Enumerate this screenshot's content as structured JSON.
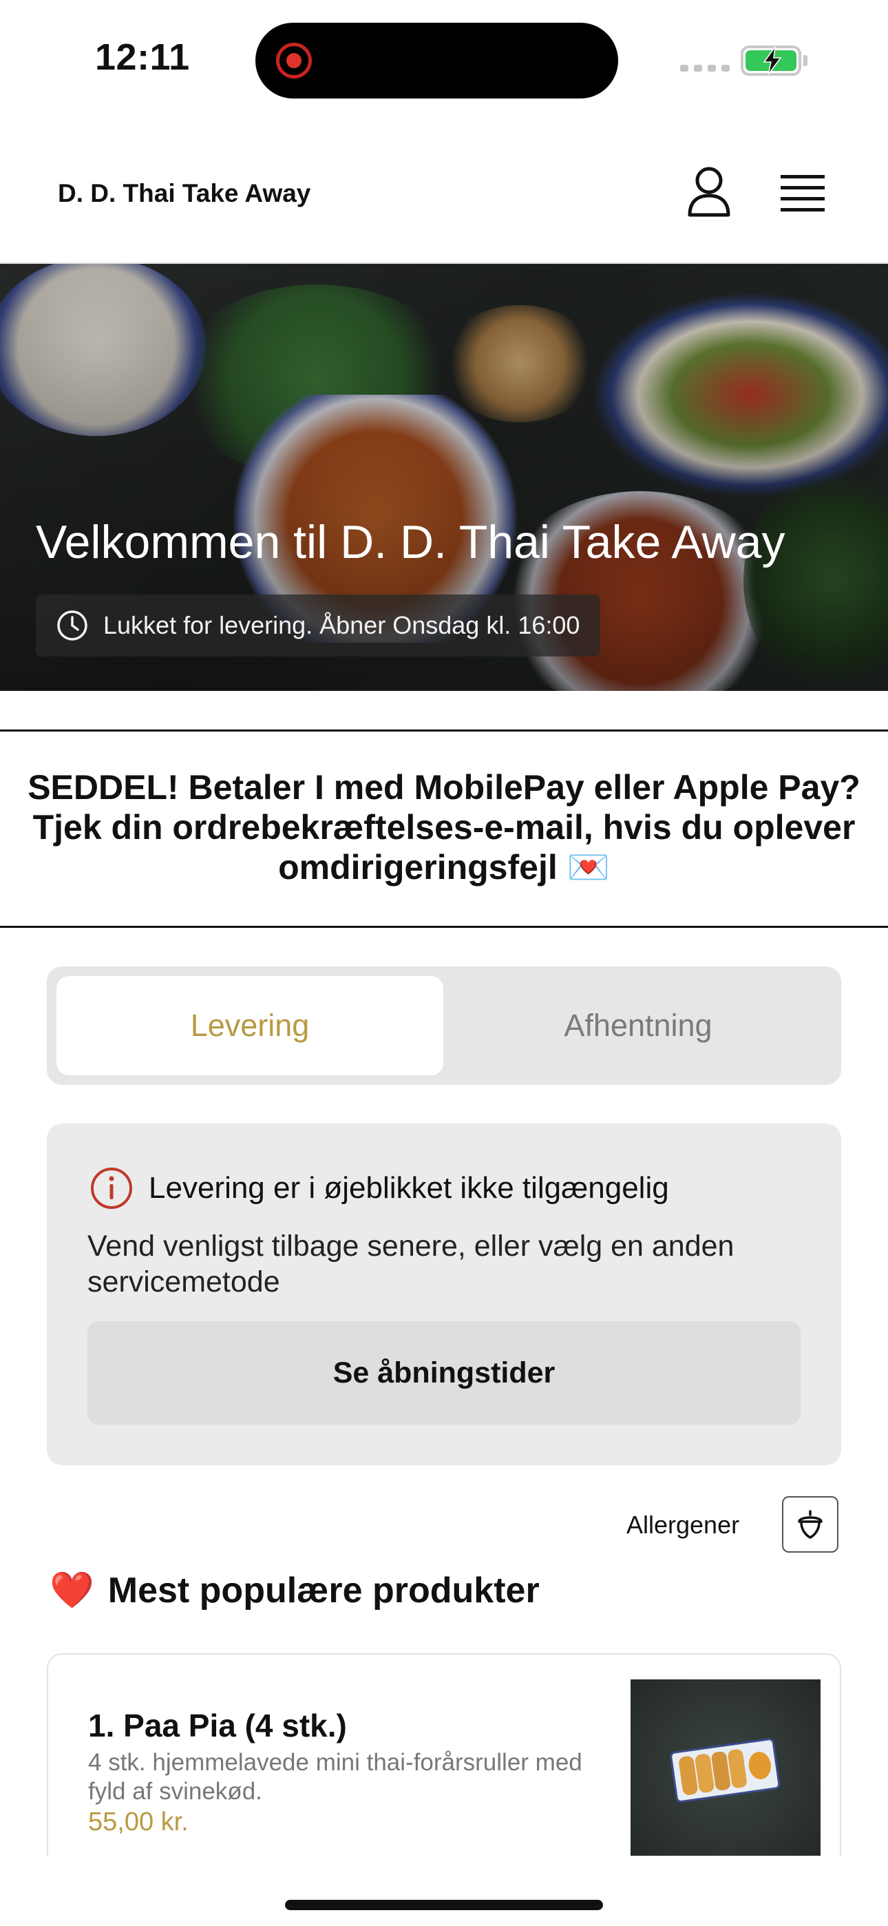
{
  "status_bar": {
    "time": "12:11"
  },
  "header": {
    "brand": "D. D. Thai Take Away"
  },
  "hero": {
    "title": "Velkommen til D. D. Thai Take Away",
    "status": "Lukket for levering. Åbner Onsdag kl. 16:00"
  },
  "notice": {
    "text": "SEDDEL! Betaler I med MobilePay eller Apple Pay? Tjek din ordrebekræftelses-e-mail, hvis du oplever omdirigeringsfejl 💌"
  },
  "service_toggle": {
    "options": [
      "Levering",
      "Afhentning"
    ],
    "selected": "Levering"
  },
  "alert": {
    "title": "Levering er i øjeblikket ikke tilgængelig",
    "message": "Vend venligst tilbage senere, eller vælg en anden servicemetode",
    "button": "Se åbningstider"
  },
  "allergens": {
    "label": "Allergener"
  },
  "section": {
    "emoji": "❤️",
    "title": "Mest populære produkter"
  },
  "products": [
    {
      "name": "1. Paa Pia (4 stk.)",
      "description": "4 stk. hjemmelavede mini thai-forårsruller med fyld af svinekød.",
      "price": "55,00 kr."
    }
  ],
  "colors": {
    "accent": "#b99a43",
    "alert_icon": "#c0392b",
    "battery": "#34c759"
  }
}
